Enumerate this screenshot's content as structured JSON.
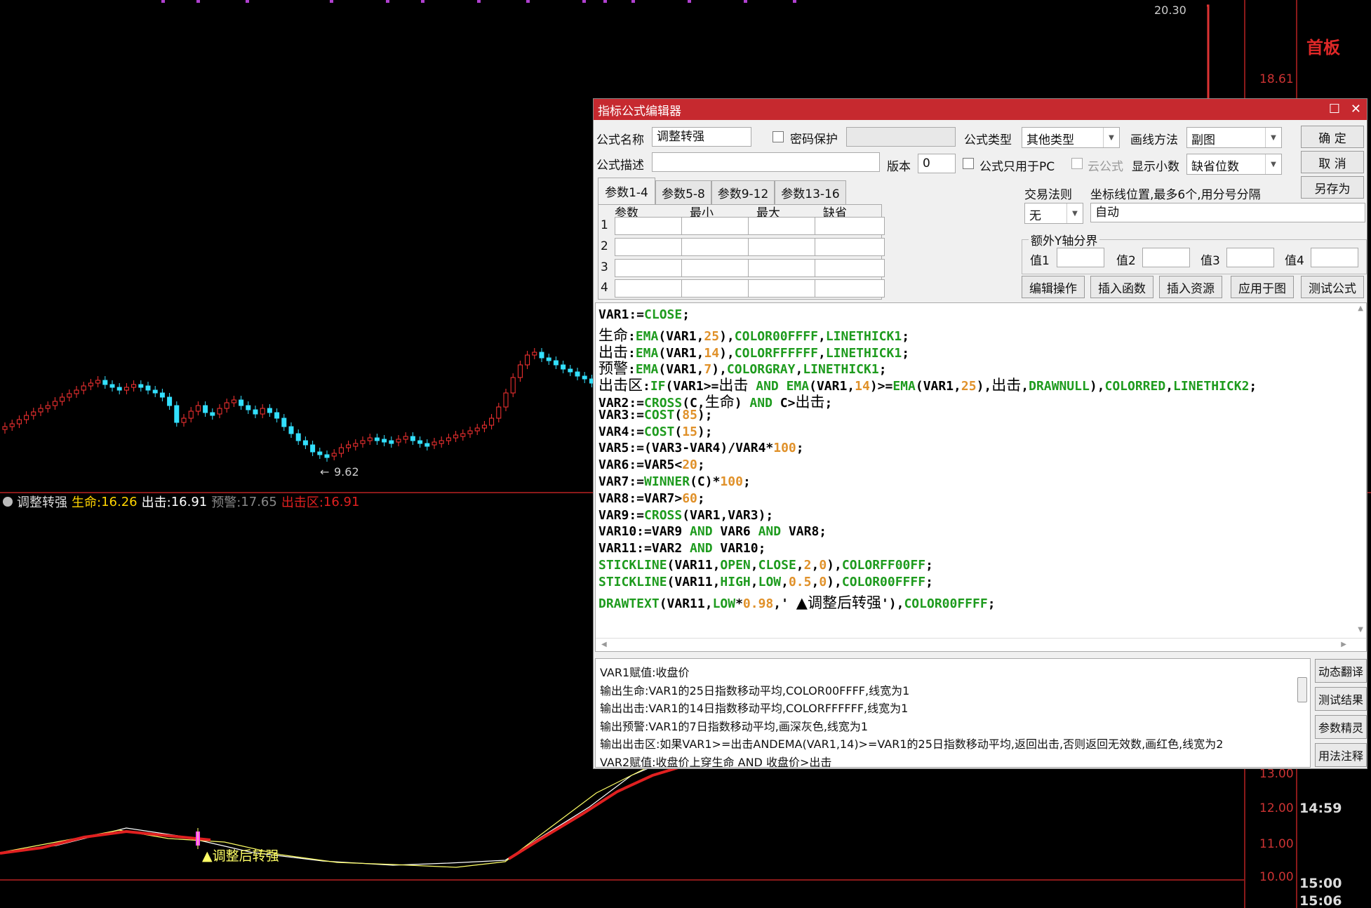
{
  "chart": {
    "top_price_label": "20.30",
    "low_price_label": "9.62",
    "right_panel_label": "首板",
    "price_axis": [
      "18.61",
      "13.00",
      "12.00",
      "11.00",
      "10.00"
    ],
    "time_labels": [
      "14:59",
      "15:00",
      "15:06"
    ],
    "signal_text": "▲调整后转强"
  },
  "indicator_bar": {
    "name": "调整转强",
    "life_label": "生命:",
    "life_value": "16.26",
    "strike_label": "出击:",
    "strike_value": "16.91",
    "warn_label": "预警:",
    "warn_value": "17.65",
    "zone_label": "出击区:",
    "zone_value": "16.91"
  },
  "dialog": {
    "title": "指标公式编辑器",
    "formula_name_label": "公式名称",
    "formula_name_value": "调整转强",
    "password_label": "密码保护",
    "formula_type_label": "公式类型",
    "formula_type_value": "其他类型",
    "draw_method_label": "画线方法",
    "draw_method_value": "副图",
    "ok_button": "确  定",
    "cancel_button": "取  消",
    "save_as_button": "另存为",
    "desc_label": "公式描述",
    "version_label": "版本",
    "version_value": "0",
    "pc_only_label": "公式只用于PC",
    "cloud_label": "云公式",
    "show_decimal_label": "显示小数",
    "show_decimal_value": "缺省位数",
    "tabs": [
      "参数1-4",
      "参数5-8",
      "参数9-12",
      "参数13-16"
    ],
    "param_headers": [
      "参数",
      "最小",
      "最大",
      "缺省"
    ],
    "param_rows": [
      "1",
      "2",
      "3",
      "4"
    ],
    "trade_rule_label": "交易法则",
    "trade_rule_value": "无",
    "axis_pos_label": "坐标线位置,最多6个,用分号分隔",
    "axis_pos_value": "自动",
    "extra_y_label": "额外Y轴分界",
    "y_values": [
      "值1",
      "值2",
      "值3",
      "值4"
    ],
    "action_buttons": [
      "编辑操作",
      "插入函数",
      "插入资源",
      "应用于图",
      "测试公式"
    ],
    "explain_lines": [
      "VAR1赋值:收盘价",
      "输出生命:VAR1的25日指数移动平均,COLOR00FFFF,线宽为1",
      "输出出击:VAR1的14日指数移动平均,COLORFFFFFF,线宽为1",
      "输出预警:VAR1的7日指数移动平均,画深灰色,线宽为1",
      "输出出击区:如果VAR1>=出击ANDEMA(VAR1,14)>=VAR1的25日指数移动平均,返回出击,否则返回无效数,画红色,线宽为2",
      "VAR2赋值:收盘价上穿生命 AND 收盘价>出击"
    ],
    "side_buttons": [
      "动态翻译",
      "测试结果",
      "参数精灵",
      "用法注释"
    ]
  },
  "code_lines": [
    [
      [
        "t",
        "VAR1:="
      ],
      [
        "k",
        "CLOSE"
      ],
      [
        "t",
        ";"
      ]
    ],
    [
      [
        "c",
        "生命"
      ],
      [
        "t",
        ":"
      ],
      [
        "k",
        "EMA"
      ],
      [
        "t",
        "(VAR1,"
      ],
      [
        "n",
        "25"
      ],
      [
        "t",
        "),"
      ],
      [
        "k",
        "COLOR00FFFF"
      ],
      [
        "t",
        ","
      ],
      [
        "k",
        "LINETHICK1"
      ],
      [
        "t",
        ";"
      ]
    ],
    [
      [
        "c",
        "出击"
      ],
      [
        "t",
        ":"
      ],
      [
        "k",
        "EMA"
      ],
      [
        "t",
        "(VAR1,"
      ],
      [
        "n",
        "14"
      ],
      [
        "t",
        "),"
      ],
      [
        "k",
        "COLORFFFFFF"
      ],
      [
        "t",
        ","
      ],
      [
        "k",
        "LINETHICK1"
      ],
      [
        "t",
        ";"
      ]
    ],
    [
      [
        "c",
        "预警"
      ],
      [
        "t",
        ":"
      ],
      [
        "k",
        "EMA"
      ],
      [
        "t",
        "(VAR1,"
      ],
      [
        "n",
        "7"
      ],
      [
        "t",
        "),"
      ],
      [
        "k",
        "COLORGRAY"
      ],
      [
        "t",
        ","
      ],
      [
        "k",
        "LINETHICK1"
      ],
      [
        "t",
        ";"
      ]
    ],
    [
      [
        "c",
        "出击区"
      ],
      [
        "t",
        ":"
      ],
      [
        "k",
        "IF"
      ],
      [
        "t",
        "(VAR1>="
      ],
      [
        "c",
        "出击"
      ],
      [
        "t",
        " "
      ],
      [
        "k",
        "AND"
      ],
      [
        "t",
        " "
      ],
      [
        "k",
        "EMA"
      ],
      [
        "t",
        "(VAR1,"
      ],
      [
        "n",
        "14"
      ],
      [
        "t",
        ")>="
      ],
      [
        "k",
        "EMA"
      ],
      [
        "t",
        "(VAR1,"
      ],
      [
        "n",
        "25"
      ],
      [
        "t",
        "),"
      ],
      [
        "c",
        "出击"
      ],
      [
        "t",
        ","
      ],
      [
        "k",
        "DRAWNULL"
      ],
      [
        "t",
        "),"
      ],
      [
        "k",
        "COLORRED"
      ],
      [
        "t",
        ","
      ],
      [
        "k",
        "LINETHICK2"
      ],
      [
        "t",
        ";"
      ]
    ],
    [
      [
        "t",
        "VAR2:="
      ],
      [
        "k",
        "CROSS"
      ],
      [
        "t",
        "(C,"
      ],
      [
        "c",
        "生命"
      ],
      [
        "t",
        ") "
      ],
      [
        "k",
        "AND"
      ],
      [
        "t",
        " C>"
      ],
      [
        "c",
        "出击"
      ],
      [
        "t",
        ";"
      ]
    ],
    [
      [
        "t",
        "VAR3:="
      ],
      [
        "k",
        "COST"
      ],
      [
        "t",
        "("
      ],
      [
        "n",
        "85"
      ],
      [
        "t",
        ");"
      ]
    ],
    [
      [
        "t",
        "VAR4:="
      ],
      [
        "k",
        "COST"
      ],
      [
        "t",
        "("
      ],
      [
        "n",
        "15"
      ],
      [
        "t",
        ");"
      ]
    ],
    [
      [
        "t",
        "VAR5:=(VAR3-VAR4)/VAR4*"
      ],
      [
        "n",
        "100"
      ],
      [
        "t",
        ";"
      ]
    ],
    [
      [
        "t",
        "VAR6:=VAR5<"
      ],
      [
        "n",
        "20"
      ],
      [
        "t",
        ";"
      ]
    ],
    [
      [
        "t",
        "VAR7:="
      ],
      [
        "k",
        "WINNER"
      ],
      [
        "t",
        "(C)*"
      ],
      [
        "n",
        "100"
      ],
      [
        "t",
        ";"
      ]
    ],
    [
      [
        "t",
        "VAR8:=VAR7>"
      ],
      [
        "n",
        "60"
      ],
      [
        "t",
        ";"
      ]
    ],
    [
      [
        "t",
        "VAR9:="
      ],
      [
        "k",
        "CROSS"
      ],
      [
        "t",
        "(VAR1,VAR3);"
      ]
    ],
    [
      [
        "t",
        "VAR10:=VAR9 "
      ],
      [
        "k",
        "AND"
      ],
      [
        "t",
        " VAR6 "
      ],
      [
        "k",
        "AND"
      ],
      [
        "t",
        " VAR8;"
      ]
    ],
    [
      [
        "t",
        "VAR11:=VAR2 "
      ],
      [
        "k",
        "AND"
      ],
      [
        "t",
        " VAR10;"
      ]
    ],
    [
      [
        "k",
        "STICKLINE"
      ],
      [
        "t",
        "(VAR11,"
      ],
      [
        "k",
        "OPEN"
      ],
      [
        "t",
        ","
      ],
      [
        "k",
        "CLOSE"
      ],
      [
        "t",
        ","
      ],
      [
        "n",
        "2"
      ],
      [
        "t",
        ","
      ],
      [
        "n",
        "0"
      ],
      [
        "t",
        "),"
      ],
      [
        "k",
        "COLORFF00FF"
      ],
      [
        "t",
        ";"
      ]
    ],
    [
      [
        "k",
        "STICKLINE"
      ],
      [
        "t",
        "(VAR11,"
      ],
      [
        "k",
        "HIGH"
      ],
      [
        "t",
        ","
      ],
      [
        "k",
        "LOW"
      ],
      [
        "t",
        ","
      ],
      [
        "n",
        "0.5"
      ],
      [
        "t",
        ","
      ],
      [
        "n",
        "0"
      ],
      [
        "t",
        "),"
      ],
      [
        "k",
        "COLOR00FFFF"
      ],
      [
        "t",
        ";"
      ]
    ],
    [
      [
        "k",
        "DRAWTEXT"
      ],
      [
        "t",
        "(VAR11,"
      ],
      [
        "k",
        "LOW"
      ],
      [
        "t",
        "*"
      ],
      [
        "n",
        "0.98"
      ],
      [
        "t",
        ",' "
      ],
      [
        "c",
        "▲调整后转强"
      ],
      [
        "t",
        "'),"
      ],
      [
        "k",
        "COLOR00FFFF"
      ],
      [
        "t",
        ";"
      ]
    ]
  ]
}
